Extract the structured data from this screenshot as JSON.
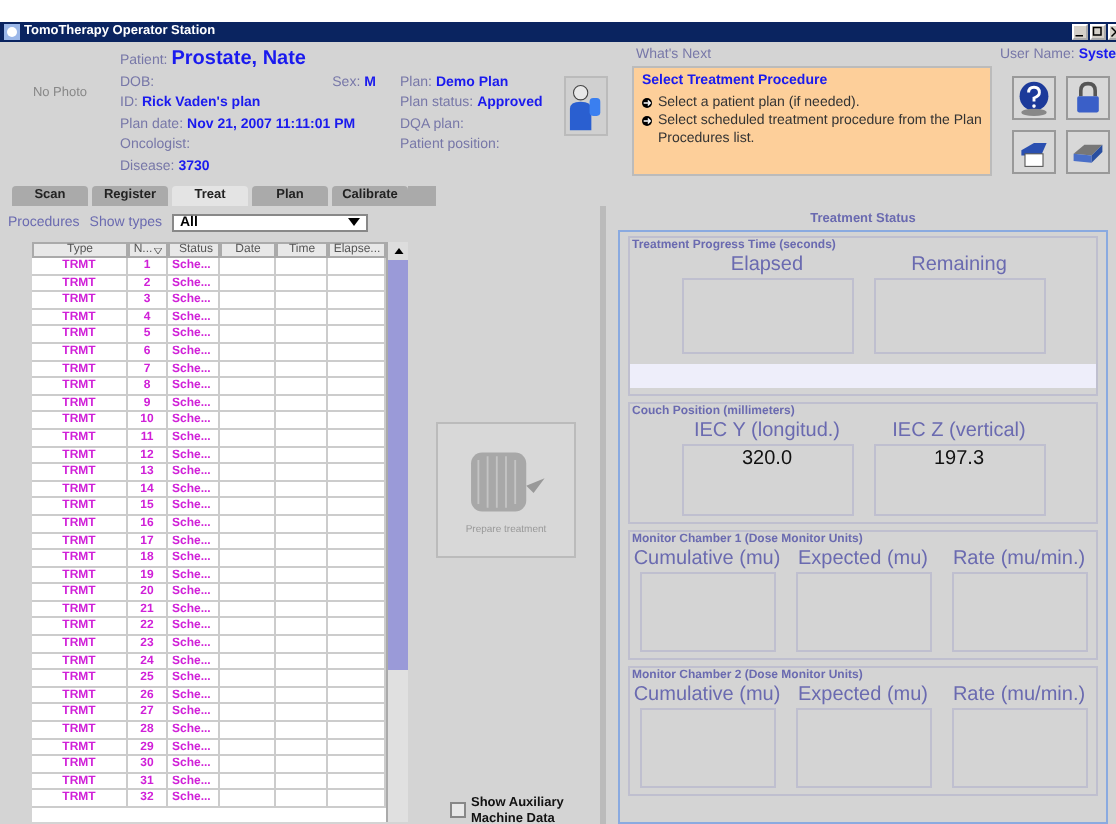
{
  "window": {
    "title": "TomoTherapy Operator Station"
  },
  "patient": {
    "photo": "No Photo",
    "name_label": "Patient:",
    "name": "Prostate, Nate",
    "fields": [
      {
        "label": "DOB:"
      },
      {
        "label": "ID:",
        "value": "Rick Vaden's plan"
      },
      {
        "label": "Plan date:",
        "value": "Nov 21, 2007 11:11:01 PM"
      },
      {
        "label": "Oncologist:"
      },
      {
        "label": "Disease:",
        "value": "3730"
      }
    ],
    "sex": {
      "label": "Sex:",
      "value": "M"
    },
    "plan_fields": [
      {
        "label": "Plan:",
        "value": "Demo Plan"
      },
      {
        "label": "Plan status:",
        "value": "Approved"
      },
      {
        "label": "DQA plan:"
      },
      {
        "label": "Patient position:"
      }
    ]
  },
  "whats_next": {
    "label": "What's Next",
    "title": "Select Treatment Procedure",
    "steps": [
      "Select a patient plan (if needed).",
      "Select scheduled treatment procedure from the Plan Procedures list."
    ]
  },
  "user": {
    "label": "User Name:",
    "value": "Syste"
  },
  "tabs": [
    {
      "label": "Scan",
      "selected": false
    },
    {
      "label": "Register",
      "selected": false
    },
    {
      "label": "Treat",
      "selected": true
    },
    {
      "label": "Plan",
      "selected": false
    },
    {
      "label": "Calibrate",
      "selected": false
    }
  ],
  "procedures": {
    "label": "Procedures",
    "filter_label": "Show types",
    "filter_value": "All"
  },
  "table": {
    "columns": [
      "Type",
      "N...",
      "Status",
      "Date",
      "Time",
      "Elapse..."
    ],
    "rows": [
      {
        "type": "TRMT",
        "number": "1",
        "status": "Sche..."
      },
      {
        "type": "TRMT",
        "number": "2",
        "status": "Sche..."
      },
      {
        "type": "TRMT",
        "number": "3",
        "status": "Sche..."
      },
      {
        "type": "TRMT",
        "number": "4",
        "status": "Sche..."
      },
      {
        "type": "TRMT",
        "number": "5",
        "status": "Sche..."
      },
      {
        "type": "TRMT",
        "number": "6",
        "status": "Sche..."
      },
      {
        "type": "TRMT",
        "number": "7",
        "status": "Sche..."
      },
      {
        "type": "TRMT",
        "number": "8",
        "status": "Sche..."
      },
      {
        "type": "TRMT",
        "number": "9",
        "status": "Sche..."
      },
      {
        "type": "TRMT",
        "number": "10",
        "status": "Sche..."
      },
      {
        "type": "TRMT",
        "number": "11",
        "status": "Sche..."
      },
      {
        "type": "TRMT",
        "number": "12",
        "status": "Sche..."
      },
      {
        "type": "TRMT",
        "number": "13",
        "status": "Sche..."
      },
      {
        "type": "TRMT",
        "number": "14",
        "status": "Sche..."
      },
      {
        "type": "TRMT",
        "number": "15",
        "status": "Sche..."
      },
      {
        "type": "TRMT",
        "number": "16",
        "status": "Sche..."
      },
      {
        "type": "TRMT",
        "number": "17",
        "status": "Sche..."
      },
      {
        "type": "TRMT",
        "number": "18",
        "status": "Sche..."
      },
      {
        "type": "TRMT",
        "number": "19",
        "status": "Sche..."
      },
      {
        "type": "TRMT",
        "number": "20",
        "status": "Sche..."
      },
      {
        "type": "TRMT",
        "number": "21",
        "status": "Sche..."
      },
      {
        "type": "TRMT",
        "number": "22",
        "status": "Sche..."
      },
      {
        "type": "TRMT",
        "number": "23",
        "status": "Sche..."
      },
      {
        "type": "TRMT",
        "number": "24",
        "status": "Sche..."
      },
      {
        "type": "TRMT",
        "number": "25",
        "status": "Sche..."
      },
      {
        "type": "TRMT",
        "number": "26",
        "status": "Sche..."
      },
      {
        "type": "TRMT",
        "number": "27",
        "status": "Sche..."
      },
      {
        "type": "TRMT",
        "number": "28",
        "status": "Sche..."
      },
      {
        "type": "TRMT",
        "number": "29",
        "status": "Sche..."
      },
      {
        "type": "TRMT",
        "number": "30",
        "status": "Sche..."
      },
      {
        "type": "TRMT",
        "number": "31",
        "status": "Sche..."
      },
      {
        "type": "TRMT",
        "number": "32",
        "status": "Sche..."
      }
    ]
  },
  "prepare_button": {
    "label": "Prepare treatment",
    "disabled": true
  },
  "auxiliary": {
    "label": "Show Auxiliary Machine Data",
    "checked": false
  },
  "treatment_status": {
    "title": "Treatment Status",
    "progress_time": {
      "title": "Treatment Progress Time (seconds)",
      "columns": [
        {
          "label": "Elapsed"
        },
        {
          "label": "Remaining"
        }
      ],
      "progress": {
        "level": 0
      }
    },
    "couch": {
      "title": "Couch Position (millimeters)",
      "columns": [
        {
          "label": "IEC Y (longitud.)",
          "value": "320.0"
        },
        {
          "label": "IEC Z (vertical)",
          "value": "197.3"
        }
      ]
    },
    "chambers": [
      {
        "title": "Monitor Chamber 1 (Dose Monitor Units)",
        "columns": [
          {
            "label": "Cumulative (mu)"
          },
          {
            "label": "Expected (mu)"
          },
          {
            "label": "Rate (mu/min.)"
          }
        ]
      },
      {
        "title": "Monitor Chamber 2 (Dose Monitor Units)",
        "columns": [
          {
            "label": "Cumulative (mu)"
          },
          {
            "label": "Expected (mu)"
          },
          {
            "label": "Rate (mu/min.)"
          }
        ]
      }
    ]
  }
}
